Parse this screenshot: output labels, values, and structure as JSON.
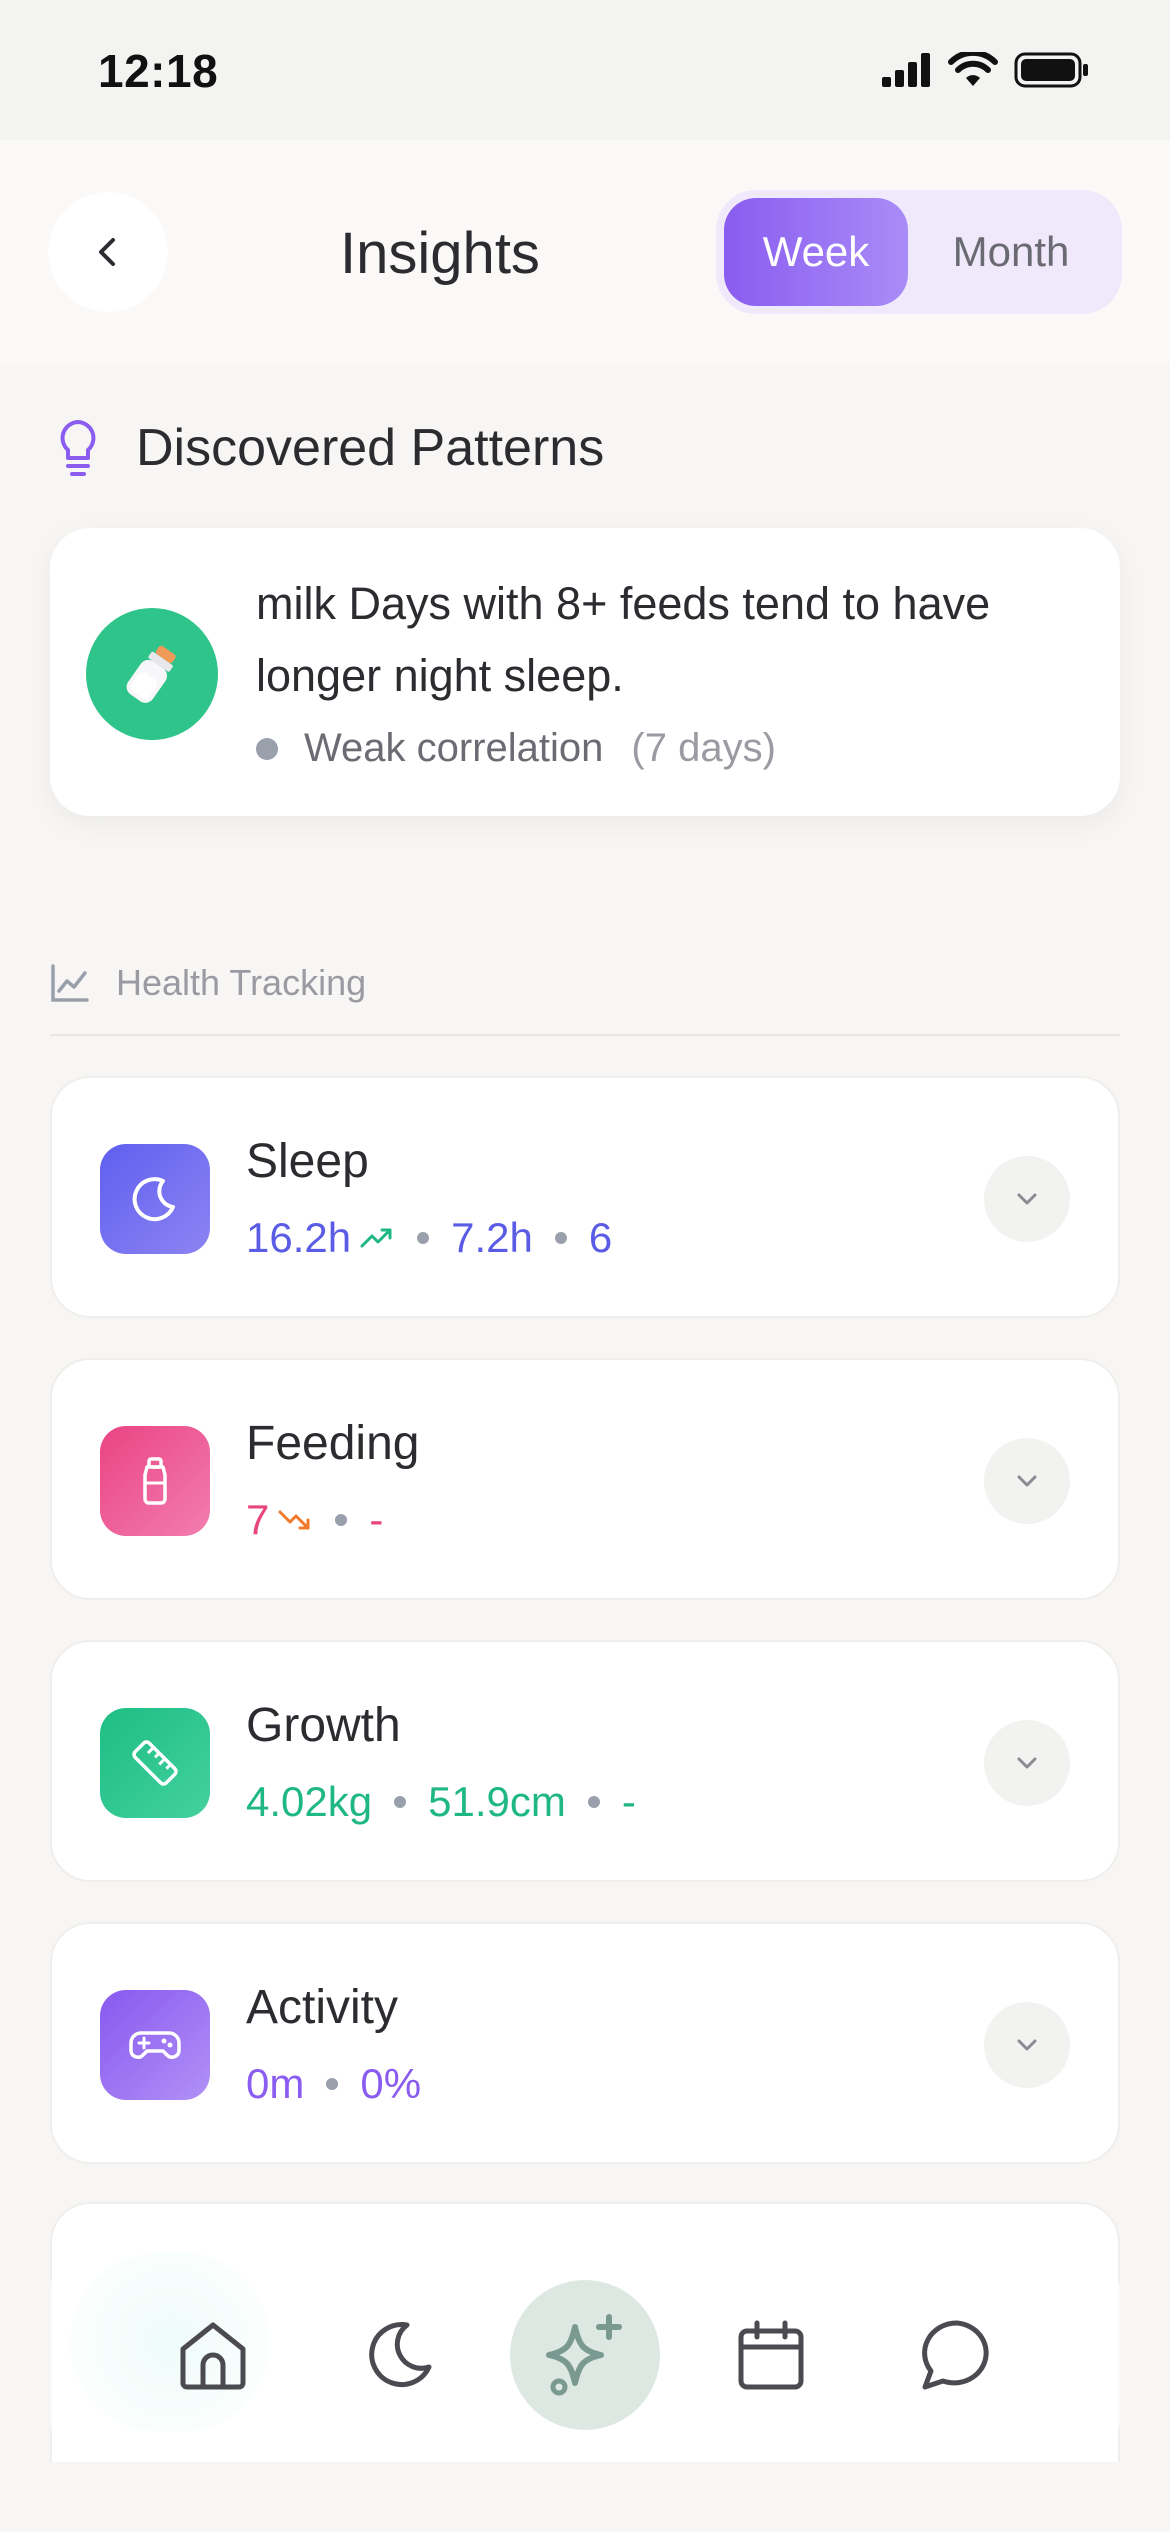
{
  "status_bar": {
    "time": "12:18"
  },
  "header": {
    "title": "Insights",
    "segmented": {
      "options": [
        "Week",
        "Month"
      ],
      "selected": "Week"
    }
  },
  "patterns": {
    "section_title": "Discovered Patterns",
    "items": [
      {
        "text": "milk Days with 8+ feeds tend to have longer night sleep.",
        "strength": "Weak correlation",
        "period": "(7 days)",
        "icon": "milk-bottle-icon"
      }
    ]
  },
  "health": {
    "section_title": "Health Tracking",
    "metrics": [
      {
        "title": "Sleep",
        "color": "#5b5ce6",
        "icon": "moon-icon",
        "values": [
          "16.2h",
          "7.2h",
          "6"
        ],
        "trend": "up"
      },
      {
        "title": "Feeding",
        "color": "#e8457f",
        "icon": "bottle-icon",
        "values": [
          "7",
          "-"
        ],
        "trend": "down"
      },
      {
        "title": "Growth",
        "color": "#20b882",
        "icon": "ruler-icon",
        "values": [
          "4.02kg",
          "51.9cm",
          "-"
        ]
      },
      {
        "title": "Activity",
        "color": "#8b5cf0",
        "icon": "gamepad-icon",
        "values": [
          "0m",
          "0%"
        ]
      }
    ]
  },
  "colors": {
    "accent": "#8a5cf0",
    "trend_up": "#20b882",
    "trend_down": "#f07a2a"
  },
  "tabbar": {
    "tabs": [
      "home",
      "sleep",
      "insights",
      "calendar",
      "chat"
    ],
    "active": "insights"
  }
}
